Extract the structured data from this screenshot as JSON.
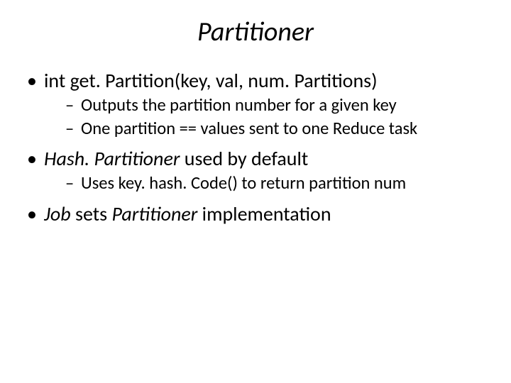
{
  "title": "Partitioner",
  "b1_text": "int get. Partition(key, val, num. Partitions)",
  "b1_s1": "Outputs the partition number for a given key",
  "b1_s2": "One partition == values sent to one Reduce task",
  "b2_ital": "Hash. Partitioner",
  "b2_rest": " used by default",
  "b2_s1": "Uses key. hash. Code() to return partition num",
  "b3_ital1": "Job",
  "b3_mid": " sets ",
  "b3_ital2": "Partitioner",
  "b3_rest": " implementation"
}
